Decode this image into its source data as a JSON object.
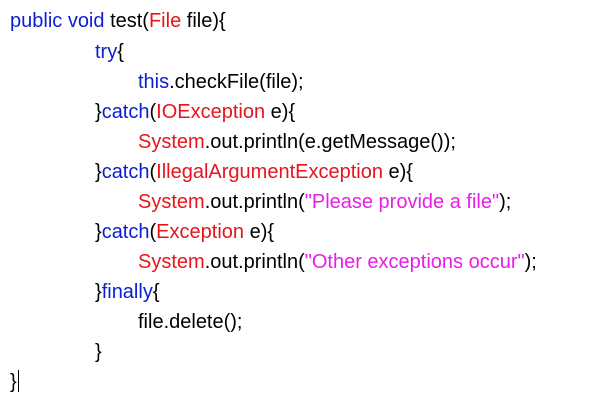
{
  "colors": {
    "keyword": "#0a1ed2",
    "type": "#e8141c",
    "string": "#e81ee8",
    "plain": "#000000",
    "background": "#ffffff"
  },
  "code": {
    "lines": [
      {
        "indent": "",
        "tokens": [
          {
            "type": "keyword",
            "text": "public void"
          },
          {
            "type": "plain",
            "text": " test("
          },
          {
            "type": "type",
            "text": "File"
          },
          {
            "type": "plain",
            "text": " file){"
          }
        ]
      },
      {
        "indent": "\t",
        "tokens": [
          {
            "type": "keyword",
            "text": "try"
          },
          {
            "type": "plain",
            "text": "{"
          }
        ]
      },
      {
        "indent": "\t\t",
        "tokens": [
          {
            "type": "keyword",
            "text": "this"
          },
          {
            "type": "plain",
            "text": ".checkFile(file);"
          }
        ]
      },
      {
        "indent": "\t",
        "tokens": [
          {
            "type": "plain",
            "text": "}"
          },
          {
            "type": "keyword",
            "text": "catch"
          },
          {
            "type": "plain",
            "text": "("
          },
          {
            "type": "type",
            "text": "IOException"
          },
          {
            "type": "plain",
            "text": " e){"
          }
        ]
      },
      {
        "indent": "\t\t",
        "tokens": [
          {
            "type": "type",
            "text": "System"
          },
          {
            "type": "plain",
            "text": ".out.println(e.getMessage());"
          }
        ]
      },
      {
        "indent": "\t",
        "tokens": [
          {
            "type": "plain",
            "text": "}"
          },
          {
            "type": "keyword",
            "text": "catch"
          },
          {
            "type": "plain",
            "text": "("
          },
          {
            "type": "type",
            "text": "IllegalArgumentException"
          },
          {
            "type": "plain",
            "text": " e){"
          }
        ]
      },
      {
        "indent": "\t\t",
        "tokens": [
          {
            "type": "type",
            "text": "System"
          },
          {
            "type": "plain",
            "text": ".out.println("
          },
          {
            "type": "string",
            "text": "\"Please provide a file\""
          },
          {
            "type": "plain",
            "text": ");"
          }
        ]
      },
      {
        "indent": "\t",
        "tokens": [
          {
            "type": "plain",
            "text": "}"
          },
          {
            "type": "keyword",
            "text": "catch"
          },
          {
            "type": "plain",
            "text": "("
          },
          {
            "type": "type",
            "text": "Exception"
          },
          {
            "type": "plain",
            "text": " e){"
          }
        ]
      },
      {
        "indent": "\t\t",
        "tokens": [
          {
            "type": "type",
            "text": "System"
          },
          {
            "type": "plain",
            "text": ".out.println("
          },
          {
            "type": "string",
            "text": "\"Other exceptions occur\""
          },
          {
            "type": "plain",
            "text": ");"
          }
        ]
      },
      {
        "indent": "\t",
        "tokens": [
          {
            "type": "plain",
            "text": "}"
          },
          {
            "type": "keyword",
            "text": "finally"
          },
          {
            "type": "plain",
            "text": "{"
          }
        ]
      },
      {
        "indent": "\t\t",
        "tokens": [
          {
            "type": "plain",
            "text": "file.delete();"
          }
        ]
      },
      {
        "indent": "\t",
        "tokens": [
          {
            "type": "plain",
            "text": "}"
          }
        ]
      },
      {
        "indent": "",
        "tokens": [
          {
            "type": "plain",
            "text": "}"
          }
        ],
        "caret": true
      }
    ]
  }
}
